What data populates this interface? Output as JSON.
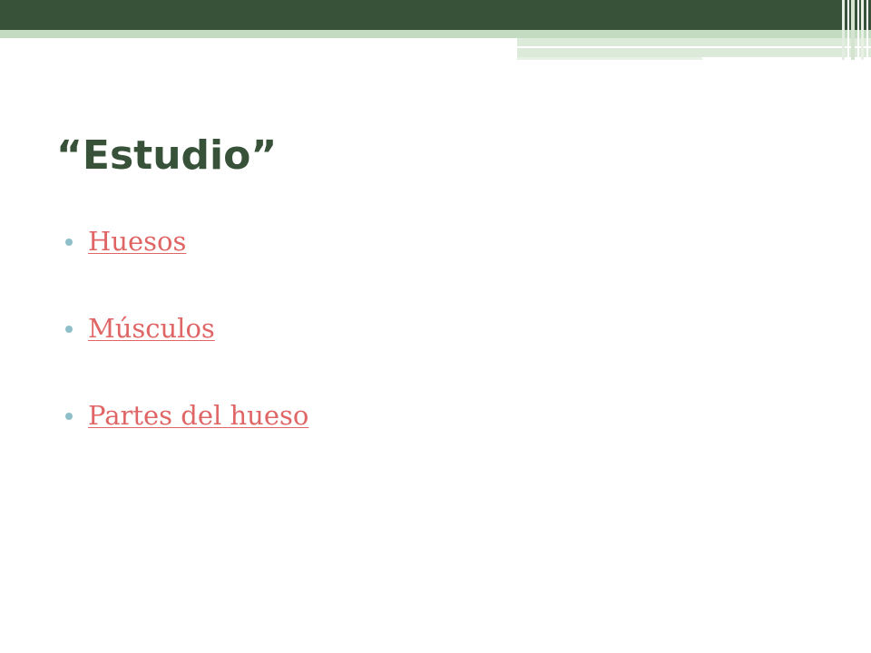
{
  "slide": {
    "title": "“Estudio”",
    "items": [
      {
        "label": "Huesos"
      },
      {
        "label": "Músculos"
      },
      {
        "label": "Partes del hueso"
      }
    ]
  },
  "colors": {
    "title": "#38523a",
    "header_band": "#38523a",
    "link": "#e06666",
    "bullet": "#8fbfc9"
  }
}
